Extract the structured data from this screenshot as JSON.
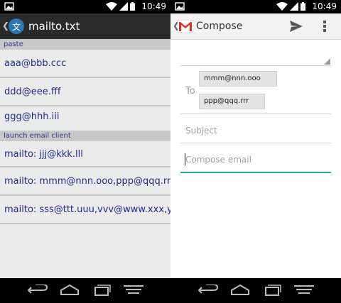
{
  "status": {
    "time": "10:49"
  },
  "left": {
    "title": "mailto.txt",
    "app_icon_glyph": "文",
    "sections": {
      "paste": "paste",
      "launch": "launch email client"
    },
    "paste_items": [
      "aaa@bbb.ccc",
      "ddd@eee.fff",
      "ggg@hhh.iii"
    ],
    "launch_items": [
      "mailto: jjj@kkk.lll",
      "mailto: mmm@nnn.ooo,ppp@qqq.rrr",
      "mailto: sss@ttt.uuu,vvv@www.xxx,y..."
    ]
  },
  "right": {
    "title": "Compose",
    "to_label": "To",
    "recipients": [
      "mmm@nnn.ooo",
      "ppp@qqq.rrr"
    ],
    "subject_placeholder": "Subject",
    "compose_placeholder": "Compose email",
    "accent_color": "#2aa39a"
  }
}
